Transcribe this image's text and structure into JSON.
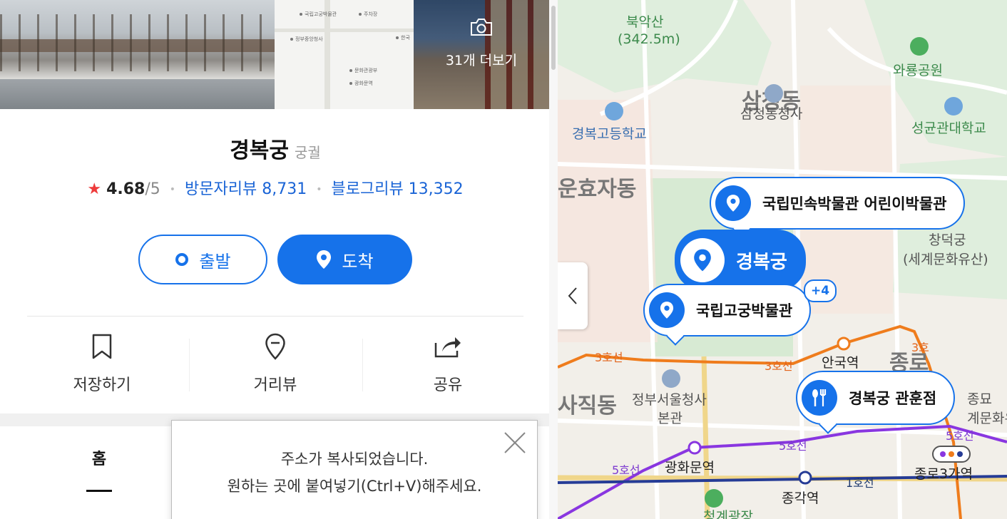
{
  "photos": {
    "more_label": "31개 더보기",
    "mini_map_labels": [
      "광화문",
      "국립고궁박물관",
      "주차장",
      "정부중앙청사",
      "한국",
      "문화관광부",
      "광화문역"
    ]
  },
  "place": {
    "name": "경복궁",
    "category": "궁궐",
    "rating": "4.68",
    "rating_max": "/5",
    "visitor_reviews": "방문자리뷰 8,731",
    "blog_reviews": "블로그리뷰 13,352"
  },
  "buttons": {
    "start": "출발",
    "destination": "도착"
  },
  "actions": {
    "save": "저장하기",
    "street_view": "거리뷰",
    "share": "공유"
  },
  "tabs": {
    "home": "홈"
  },
  "toast": {
    "line1": "주소가 복사되었습니다.",
    "line2": "원하는 곳에 붙여넣기(Ctrl+V)해주세요."
  },
  "map": {
    "labels": {
      "bugaksan": "북악산",
      "bugaksan_height": "(342.5m)",
      "waryong_park": "와룡공원",
      "samcheong_dong": "삼청동",
      "samcheong_office": "삼청동청사",
      "seonggyungwan": "성균관대학교",
      "gyeongbok_high": "경복고등학교",
      "hyoja_dong": "운효자동",
      "changdeokgung": "창덕궁",
      "changdeokgung_heritage": "(세계문화유산)",
      "sajik_dong": "사직동",
      "jongno_dong": "종로",
      "gov_complex": "정부서울청사",
      "gov_complex_annex": "본관",
      "anguk_station": "안국역",
      "gwanghwamun_station": "광화문역",
      "jonggak_station": "종각역",
      "jongno3_station": "종로3가역",
      "jongmyo": "종묘",
      "jongmyo_heritage": "계문화유",
      "cheonggye": "청계광장",
      "line3_a": "3호선",
      "line3_b": "3호선",
      "line3_c": "3호",
      "line5_a": "5호선",
      "line5_b": "5호선",
      "line5_c": "5호선",
      "line1": "1호선"
    },
    "pins": {
      "folk_museum": "국립민속박물관 어린이박물관",
      "main": "경복궁",
      "palace_museum": "국립고궁박물관",
      "restaurant": "경복궁 관훈점",
      "more_badge": "+4"
    },
    "colors": {
      "accent": "#1672ea",
      "line3": "#ef7c1c",
      "line5": "#8936e0",
      "line1": "#263c96"
    }
  }
}
